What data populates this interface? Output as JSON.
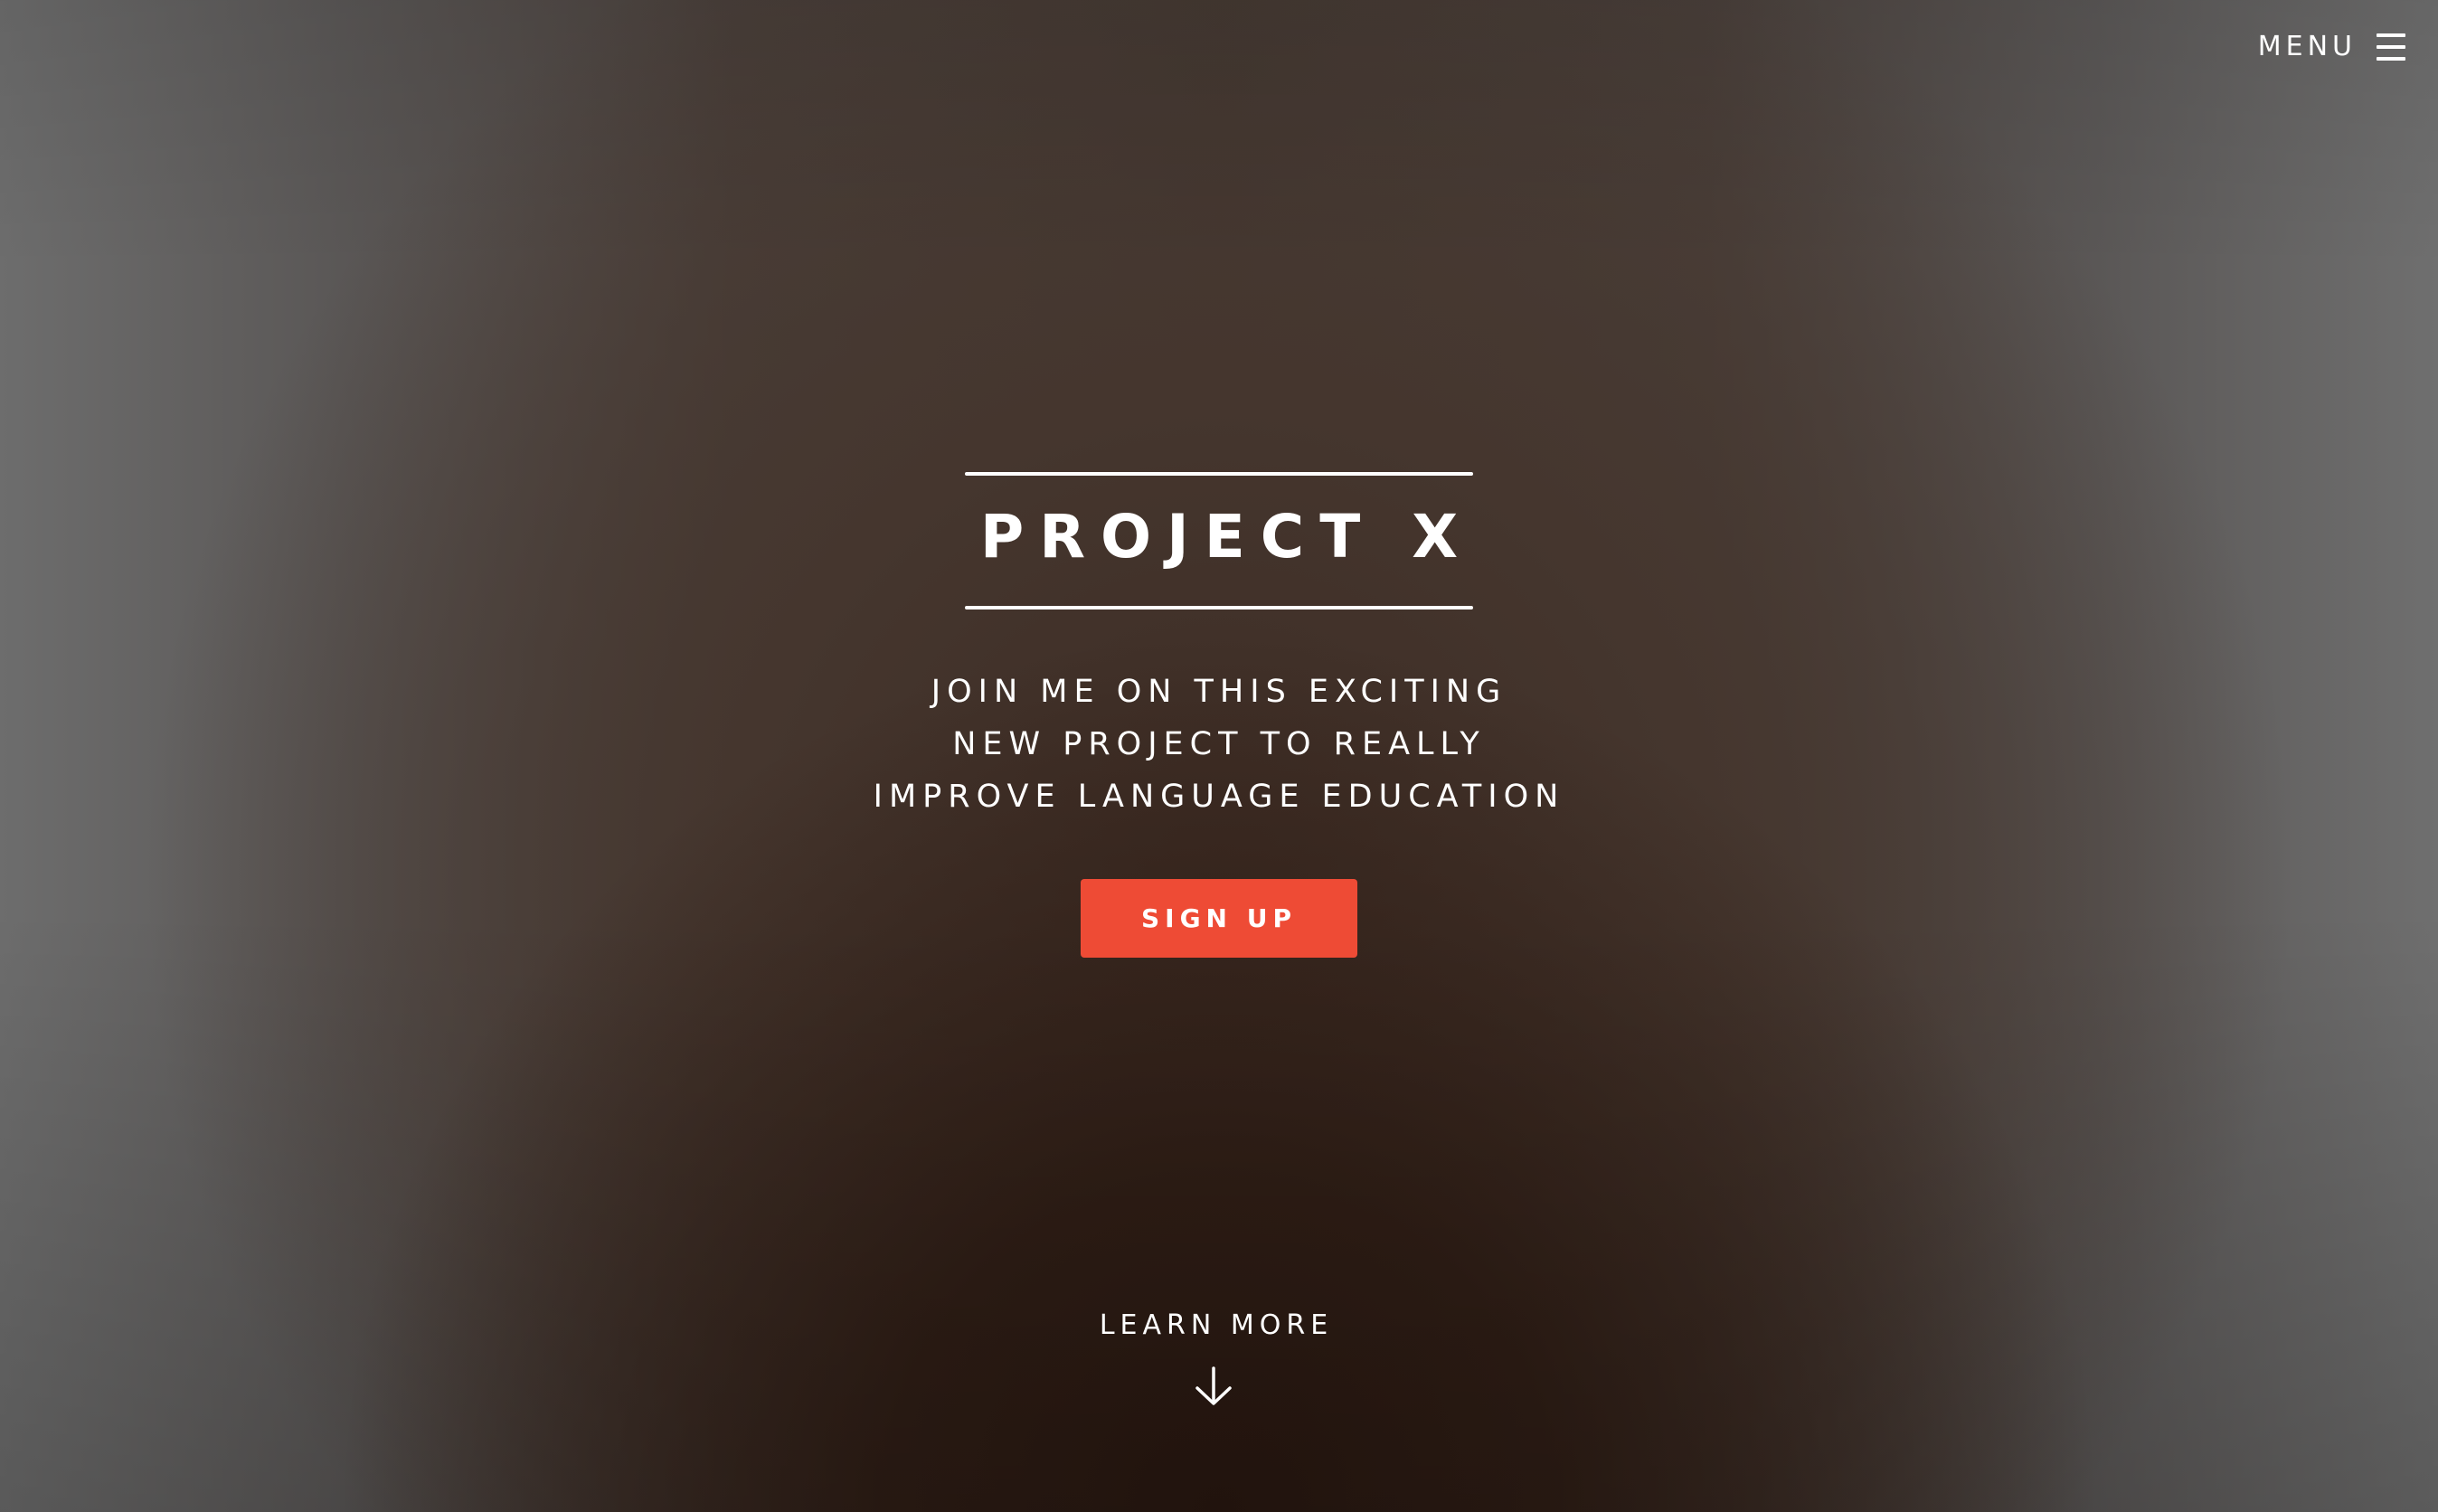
{
  "header": {
    "menu_label": "MENU",
    "menu_icon": "hamburger-icon"
  },
  "hero": {
    "title": "PROJECT X",
    "tagline_lines": [
      "JOIN ME ON THIS EXCITING",
      "NEW PROJECT TO REALLY",
      "IMPROVE LANGUAGE EDUCATION"
    ],
    "signup_label": "SIGN UP",
    "accent_color": "#ee4b35"
  },
  "footer": {
    "learn_more_label": "LEARN MORE",
    "learn_more_icon": "arrow-down-icon"
  }
}
